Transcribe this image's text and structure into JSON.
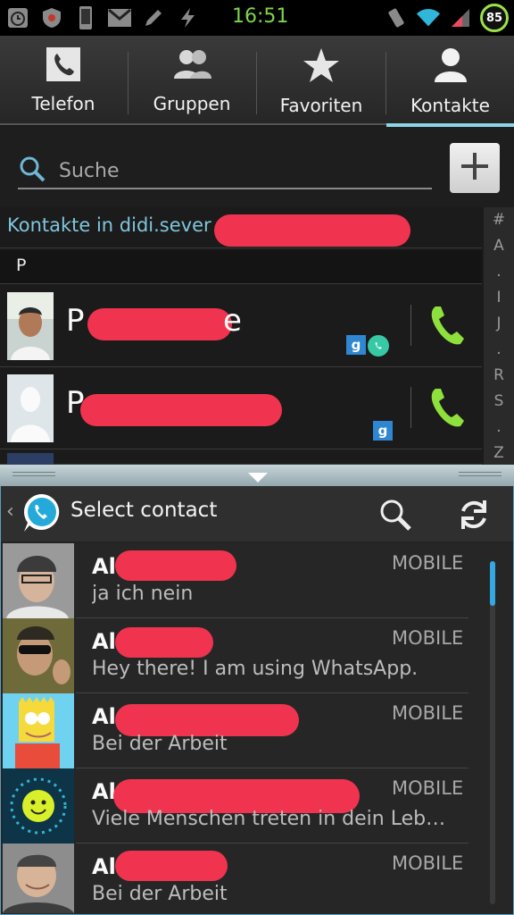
{
  "status_bar": {
    "time": "16:51",
    "battery": "85",
    "icons_left": [
      "alarm-icon",
      "shield-icon",
      "phone-icon",
      "gmail-icon",
      "pencil-icon",
      "charging-icon"
    ],
    "icons_right": [
      "vibrate-icon",
      "wifi-icon",
      "signal-icon"
    ],
    "colors": {
      "time": "#7cd64a",
      "battery_ring": "#9be24a"
    }
  },
  "tabs": [
    {
      "label": "Telefon",
      "icon": "phone-handset-icon"
    },
    {
      "label": "Gruppen",
      "icon": "group-icon"
    },
    {
      "label": "Favoriten",
      "icon": "star-icon"
    },
    {
      "label": "Kontakte",
      "icon": "person-icon",
      "active": true
    }
  ],
  "search": {
    "placeholder": "Suche",
    "add_icon": "plus-icon"
  },
  "contacts": {
    "account_header": "Kontakte in didi.sever",
    "section_letter": "P",
    "alpha_index": [
      "#",
      "A",
      ".",
      "I",
      "J",
      ".",
      "R",
      "S",
      ".",
      "Z"
    ],
    "rows": [
      {
        "name_visible_start": "P",
        "name_visible_end": "e",
        "badges": [
          "google",
          "whatsapp"
        ],
        "call_icon": "call-icon"
      },
      {
        "name_visible_start": "P",
        "name_visible_end": "",
        "badges": [
          "google"
        ],
        "call_icon": "call-icon"
      }
    ],
    "google_badge_text": "g"
  },
  "whatsapp": {
    "title": "Select contact",
    "back_glyph": "‹",
    "search_icon": "search-icon",
    "refresh_icon": "refresh-icon",
    "accent": "#34a8e0",
    "rows": [
      {
        "name": "Al",
        "type": "MOBILE",
        "status": "ja ich nein"
      },
      {
        "name": "Al",
        "type": "MOBILE",
        "status": "Hey there! I am using WhatsApp."
      },
      {
        "name": "Al",
        "type": "MOBILE",
        "status": "Bei der Arbeit"
      },
      {
        "name": "Al",
        "type": "MOBILE",
        "status": "Viele Menschen treten in dein Leb…"
      },
      {
        "name": "Al",
        "type": "MOBILE",
        "status": "Bei der Arbeit"
      }
    ]
  }
}
